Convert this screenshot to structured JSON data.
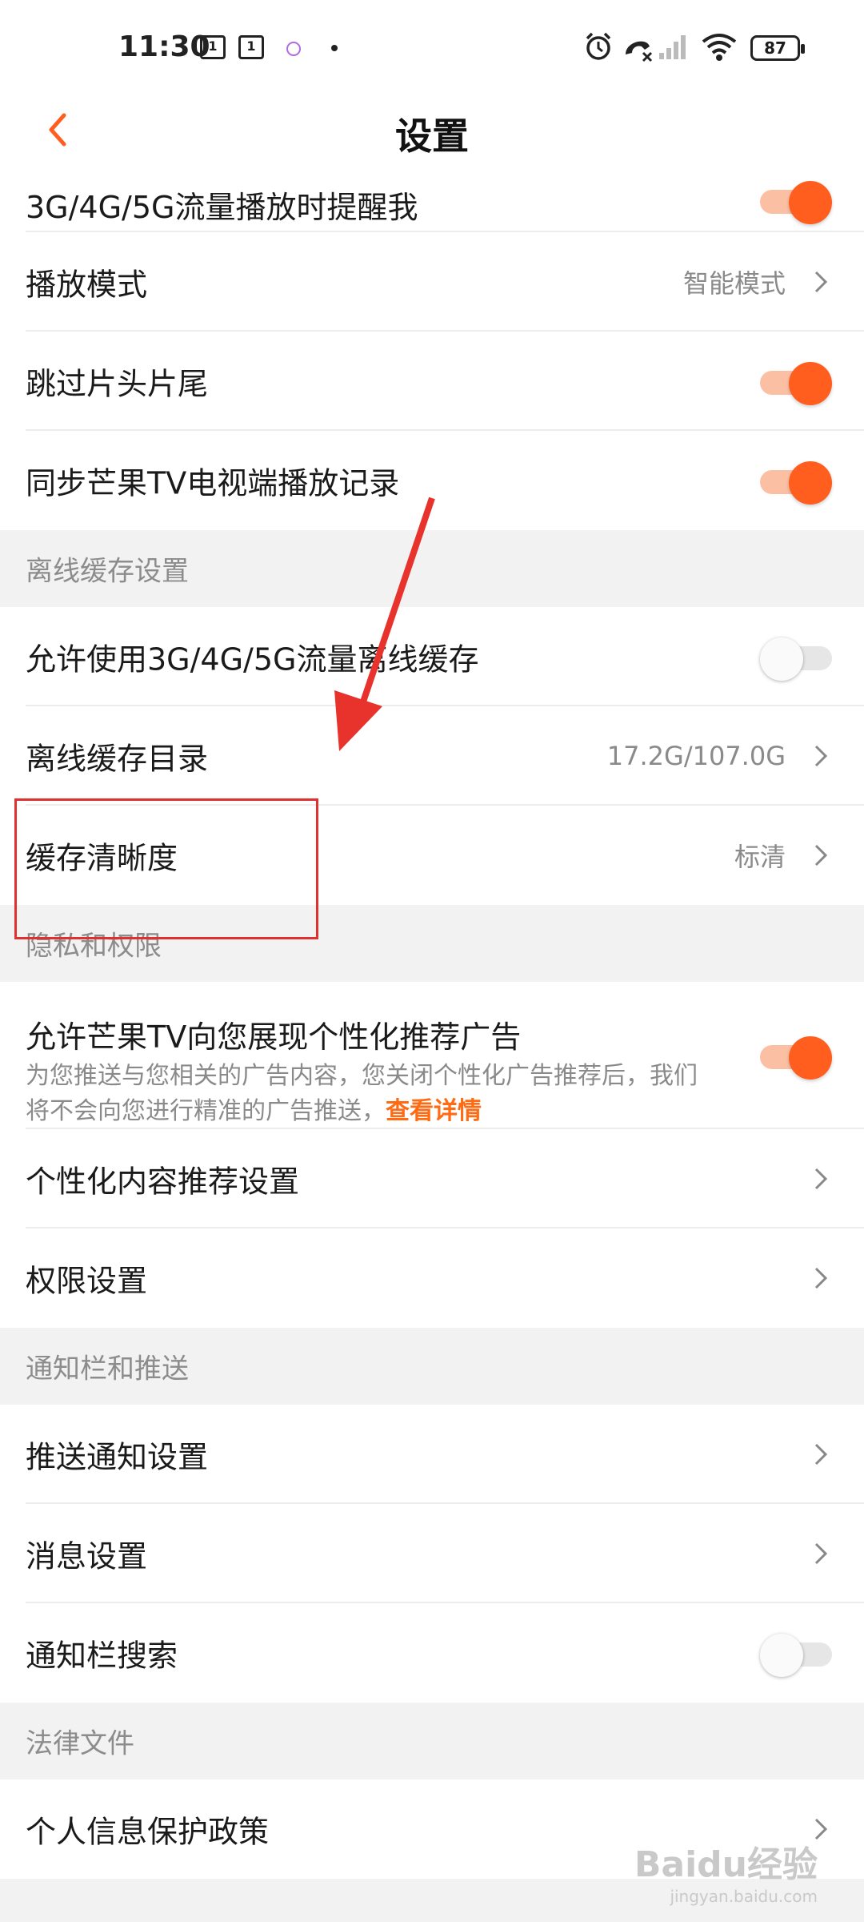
{
  "status_bar": {
    "time": "11:30",
    "notif_1": "1",
    "notif_2": "1",
    "battery": "87",
    "icons": [
      "calendar-icon",
      "calendar-icon",
      "app-dot-icon",
      "alarm-icon",
      "missed-call-icon",
      "signal-icon",
      "wifi-icon",
      "battery-icon"
    ]
  },
  "header": {
    "title": "设置",
    "back_icon": "chevron-left-icon"
  },
  "colors": {
    "accent": "#ff5e1f",
    "toggle_track_on": "#fbc0a4",
    "link": "#ff6a13",
    "annotation": "#e03030"
  },
  "rows": {
    "data_play_remind": {
      "label": "3G/4G/5G流量播放时提醒我",
      "toggle": true
    },
    "play_mode": {
      "label": "播放模式",
      "value": "智能模式"
    },
    "skip_intro": {
      "label": "跳过片头片尾",
      "toggle": true
    },
    "sync_tv": {
      "label": "同步芒果TV电视端播放记录",
      "toggle": true
    },
    "allow_data_cache": {
      "label": "允许使用3G/4G/5G流量离线缓存",
      "toggle": false
    },
    "cache_dir": {
      "label": "离线缓存目录",
      "value": "17.2G/107.0G"
    },
    "cache_quality": {
      "label": "缓存清晰度",
      "value": "标清"
    },
    "personal_ads": {
      "label": "允许芒果TV向您展现个性化推荐广告",
      "desc": "为您推送与您相关的广告内容，您关闭个性化广告推荐后，我们将不会向您进行精准的广告推送，",
      "link": "查看详情",
      "toggle": true
    },
    "content_recommend": {
      "label": "个性化内容推荐设置"
    },
    "permissions": {
      "label": "权限设置"
    },
    "push_settings": {
      "label": "推送通知设置"
    },
    "message_settings": {
      "label": "消息设置"
    },
    "notif_search": {
      "label": "通知栏搜索",
      "toggle": false
    },
    "privacy_policy": {
      "label": "个人信息保护政策"
    }
  },
  "sections": {
    "offline_cache": "离线缓存设置",
    "privacy": "隐私和权限",
    "notifications": "通知栏和推送",
    "legal": "法律文件"
  },
  "watermark": {
    "main": "Baidu经验",
    "sub": "jingyan.baidu.com"
  }
}
